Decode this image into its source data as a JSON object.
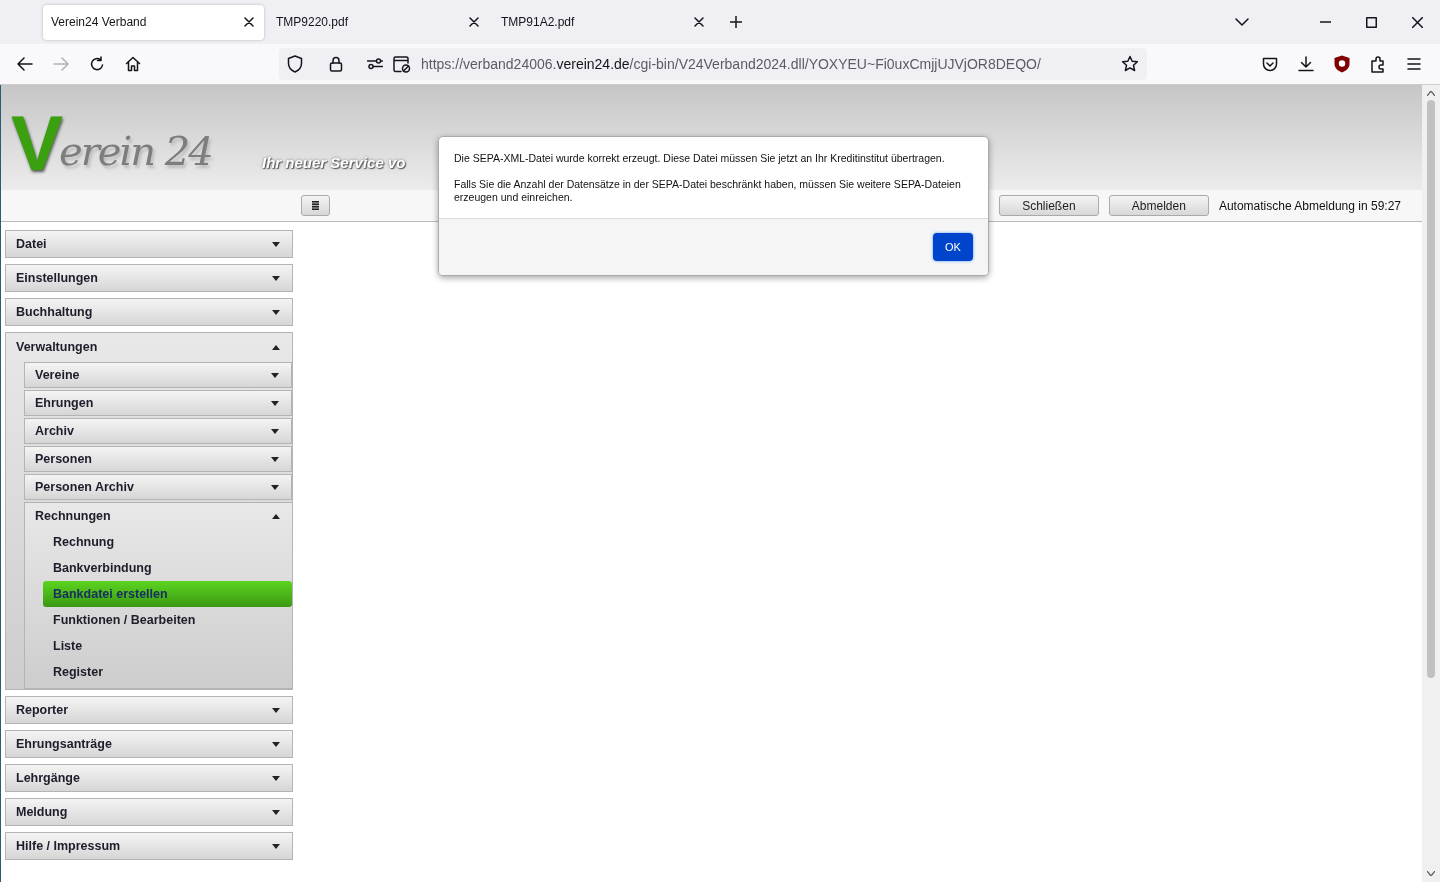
{
  "browser": {
    "tabs": [
      {
        "title": "Verein24 Verband",
        "selected": true
      },
      {
        "title": "TMP9220.pdf",
        "selected": false
      },
      {
        "title": "TMP91A2.pdf",
        "selected": false
      }
    ],
    "forward_disabled": true,
    "url": {
      "prefix": "https://verband24006.",
      "domain": "verein24.de",
      "path": "/cgi-bin/V24Verband2024.dll/YOXYEU~Fi0uxCmjjUJVjOR8DEQO/"
    }
  },
  "header": {
    "logo_initial": "V",
    "logo_text": "erein 24",
    "tagline": "Ihr neuer Service vo"
  },
  "toolbar": {
    "buttons": [
      "Schließen",
      "Abmelden"
    ],
    "auto_logout": "Automatische Abmeldung in 59:27"
  },
  "menu": [
    {
      "kind": "section",
      "label": "Datei",
      "expanded": false
    },
    {
      "kind": "section",
      "label": "Einstellungen",
      "expanded": false
    },
    {
      "kind": "section",
      "label": "Buchhaltung",
      "expanded": false
    },
    {
      "kind": "section",
      "label": "Verwaltungen",
      "expanded": true,
      "children": [
        {
          "kind": "section",
          "label": "Vereine",
          "expanded": false
        },
        {
          "kind": "section",
          "label": "Ehrungen",
          "expanded": false
        },
        {
          "kind": "section",
          "label": "Archiv",
          "expanded": false
        },
        {
          "kind": "section",
          "label": "Personen",
          "expanded": false
        },
        {
          "kind": "section",
          "label": "Personen Archiv",
          "expanded": false
        },
        {
          "kind": "section",
          "label": "Rechnungen",
          "expanded": true,
          "children": [
            {
              "kind": "link",
              "label": "Rechnung",
              "selected": false
            },
            {
              "kind": "link",
              "label": "Bankverbindung",
              "selected": false
            },
            {
              "kind": "link",
              "label": "Bankdatei erstellen",
              "selected": true
            },
            {
              "kind": "link",
              "label": "Funktionen / Bearbeiten",
              "selected": false
            },
            {
              "kind": "link",
              "label": "Liste",
              "selected": false
            },
            {
              "kind": "link",
              "label": "Register",
              "selected": false
            }
          ]
        }
      ]
    },
    {
      "kind": "section",
      "label": "Reporter",
      "expanded": false
    },
    {
      "kind": "section",
      "label": "Ehrungsanträge",
      "expanded": false
    },
    {
      "kind": "section",
      "label": "Lehrgänge",
      "expanded": false
    },
    {
      "kind": "section",
      "label": "Meldung",
      "expanded": false
    },
    {
      "kind": "section",
      "label": "Hilfe / Impressum",
      "expanded": false
    }
  ],
  "dialog": {
    "paragraphs": [
      "Die SEPA-XML-Datei wurde korrekt erzeugt. Diese Datei müssen Sie jetzt an Ihr Kreditinstitut übertragen.",
      "Falls Sie die Anzahl der Datensätze in der SEPA-Datei beschränkt haben, müssen Sie weitere SEPA-Dateien erzeugen und einreichen."
    ],
    "button": "OK"
  }
}
